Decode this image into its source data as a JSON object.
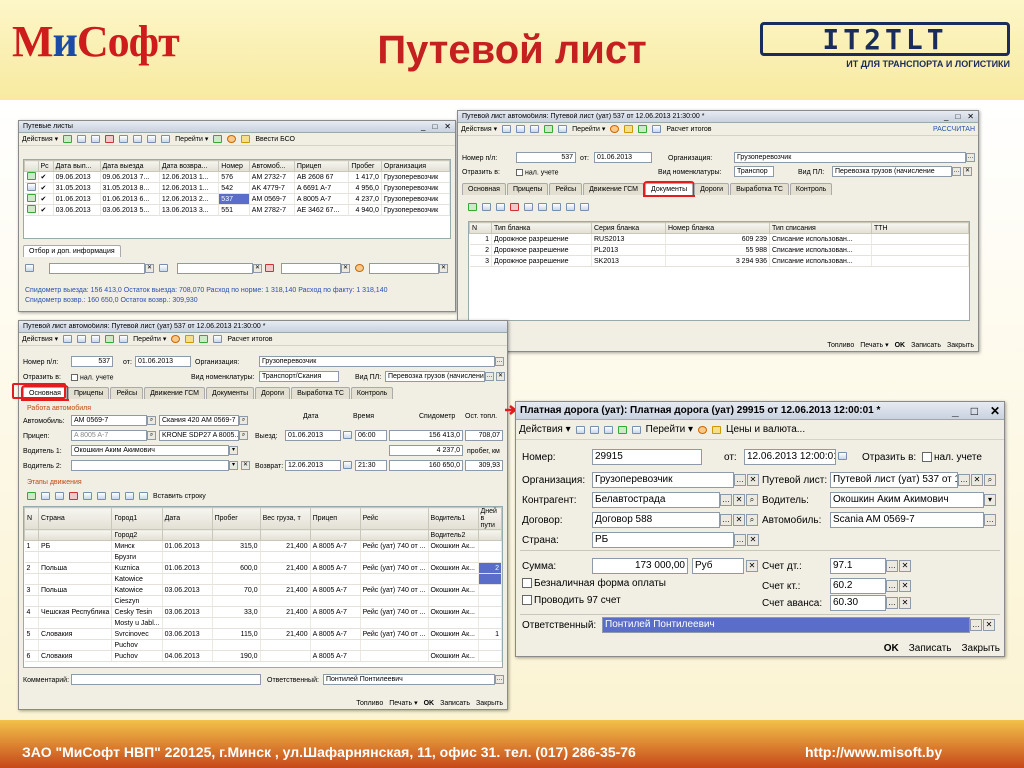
{
  "slide": {
    "logo_left_a": "М",
    "logo_left_b": "и",
    "logo_left_c": "Софт",
    "title": "Путевой лист",
    "logo_right": "IT2TLT",
    "logo_right_sub": "ИТ ДЛЯ ТРАНСПОРТА И ЛОГИСТИКИ",
    "footer_address": "ЗАО \"МиСофт НВП\"  220125, г.Минск , ул.Шафарнянская, 11, офис 31. тел. (017) 286-35-76",
    "footer_url": "http://www.misoft.by"
  },
  "w1": {
    "title": "Путевые листы",
    "toolbar": [
      "Действия ▾",
      "Перейти ▾",
      "Ввести БСО"
    ],
    "columns": [
      "Рс",
      "Дата вып...",
      "Дата выезда",
      "Дата возвра...",
      "Номер",
      "Автомоб...",
      "Прицеп",
      "Пробег",
      "Организация"
    ],
    "rows": [
      [
        "✔",
        "09.06.2013",
        "09.06.2013 7...",
        "12.06.2013 1...",
        "576",
        "AM 2732-7",
        "AB 2608 67",
        "1 417,0",
        "Грузоперевозчик"
      ],
      [
        "✔",
        "31.05.2013",
        "31.05.2013 8...",
        "12.06.2013 1...",
        "542",
        "AK 4779-7",
        "A 6691 A-7",
        "4 956,0",
        "Грузоперевозчик"
      ],
      [
        "✔",
        "01.06.2013",
        "01.06.2013 6...",
        "12.06.2013 2...",
        "537",
        "AM 0569-7",
        "A 8005 A-7",
        "4 237,0",
        "Грузоперевозчик"
      ],
      [
        "✔",
        "03.06.2013",
        "03.06.2013 5...",
        "13.06.2013 3...",
        "551",
        "AM 2782-7",
        "AE 3462 67...",
        "4 940,0",
        "Грузоперевозчик"
      ]
    ],
    "filter_tab": "Отбор и доп. информация",
    "stats1": "Спидометр выезда: 156 413,0     Остаток выезда: 708,070     Расход по норме: 1 318,140     Расход по факту: 1 318,140",
    "stats2": "Спидометр возвр.: 160 650,0     Остаток возвр.: 309,930"
  },
  "w2": {
    "title": "Путевой лист автомобиля: Путевой лист (уат) 537 от 12.06.2013 21:30:00 *",
    "toolbar": [
      "Действия ▾",
      "Перейти ▾",
      "Расчет итогов"
    ],
    "status": "РАССЧИТАН",
    "num_label": "Номер п/л:",
    "num": "537",
    "ot": "от:",
    "date": "01.06.2013",
    "org_label": "Организация:",
    "org": "Грузоперевозчик",
    "refl_label": "Отразить в:",
    "refl": "нал. учете",
    "nom_label": "Вид номенклатуры:",
    "nom": "Транспор",
    "vidpl_label": "Вид ПЛ:",
    "vidpl": "Перевозка грузов (начисление",
    "tabs": [
      "Основная",
      "Прицепы",
      "Рейсы",
      "Движение ГСМ",
      "Документы",
      "Дороги",
      "Выработка ТС",
      "Контроль"
    ],
    "columns": [
      "N",
      "Тип бланка",
      "Серия бланка",
      "Номер бланка",
      "Тип списания",
      "ТТН"
    ],
    "rows": [
      [
        "1",
        "Дорожное разрешение",
        "RUS2013",
        "609 239",
        "Списание использован...",
        ""
      ],
      [
        "2",
        "Дорожное разрешение",
        "PL2013",
        "55 988",
        "Списание использован...",
        ""
      ],
      [
        "3",
        "Дорожное разрешение",
        "SK2013",
        "3 294 936",
        "Списание использован...",
        ""
      ]
    ],
    "bottom": [
      "Топливо",
      "Печать ▾",
      "OK",
      "Записать",
      "Закрыть"
    ]
  },
  "w3": {
    "title": "Путевой лист автомобиля: Путевой лист (уат) 537 от 12.06.2013 21:30:00 *",
    "toolbar": [
      "Действия ▾",
      "Перейти ▾",
      "Расчет итогов"
    ],
    "num_label": "Номер п/л:",
    "num": "537",
    "ot": "от:",
    "date": "01.06.2013",
    "org_label": "Организация:",
    "org": "Грузоперевозчик",
    "refl_label": "Отразить в:",
    "refl": "нал. учете",
    "nom_label": "Вид номенклатуры:",
    "nom": "Транспорт/Скания",
    "vidpl_label": "Вид ПЛ:",
    "vidpl": "Перевозка грузов (начисление",
    "tabs": [
      "Основная",
      "Прицепы",
      "Рейсы",
      "Движение ГСМ",
      "Документы",
      "Дороги",
      "Выработка ТС",
      "Контроль"
    ],
    "sec_auto": "Работа автомобиля",
    "auto_label": "Автомобиль:",
    "auto": "AM 0569-7",
    "auto2": "Скания 420 AM 0569-7",
    "date_h": "Дата",
    "time_h": "Время",
    "spd_h": "Спидометр",
    "ost_h": "Ост. топл.",
    "trailer_label": "Прицеп:",
    "trailer": "A 8005 A-7",
    "trailer2": "KRONE  SDP27 A 8005...",
    "vyezd_label": "Выезд:",
    "vyezd_date": "01.06.2013",
    "vyezd_time": "06:00",
    "vyezd_spd": "156 413,0",
    "vyezd_ost": "708,07",
    "drv1_label": "Водитель 1:",
    "drv1": "Окошкин Аким Акимович",
    "run": "4 237,0",
    "run_unit": "пробег, км",
    "drv2_label": "Водитель 2:",
    "vozvr_label": "Возврат:",
    "vozvr_date": "12.06.2013",
    "vozvr_time": "21:30",
    "vozvr_spd": "160 650,0",
    "vozvr_ost": "309,93",
    "sec_route": "Этапы движения",
    "insert_row": "Вставить строку",
    "columns": [
      "N",
      "Страна",
      "Город1",
      "Дата",
      "Пробег",
      "Вес груза, т",
      "Прицеп",
      "Рейс",
      "Водитель1",
      "Дней в пути"
    ],
    "columns2": [
      "",
      "",
      "Город2",
      "",
      "",
      "",
      "",
      "",
      "Водитель2",
      ""
    ],
    "rows": [
      [
        "1",
        "РБ",
        "Минск",
        "Брузги",
        "01.06.2013",
        "315,0",
        "21,400",
        "A 8005 A-7",
        "Рейс (уат) 740 от ...",
        "Окошкин Ак...",
        ""
      ],
      [
        "2",
        "Польша",
        "Kuznica",
        "Katowice",
        "01.06.2013",
        "600,0",
        "21,400",
        "A 8005 A-7",
        "Рейс (уат) 740 от ...",
        "Окошкин Ак...",
        "2"
      ],
      [
        "3",
        "Польша",
        "Katowice",
        "Cieszyn",
        "03.06.2013",
        "70,0",
        "21,400",
        "A 8005 A-7",
        "Рейс (уат) 740 от ...",
        "Окошкин Ак...",
        ""
      ],
      [
        "4",
        "Чешская Республика",
        "Cesky Tesin",
        "Mosty u Jabl...",
        "03.06.2013",
        "33,0",
        "21,400",
        "A 8005 A-7",
        "Рейс (уат) 740 от ...",
        "Окошкин Ак...",
        ""
      ],
      [
        "5",
        "Словакия",
        "Svrcinovec",
        "Puchov",
        "03.06.2013",
        "115,0",
        "21,400",
        "A 8005 A-7",
        "Рейс (уат) 740 от ...",
        "Окошкин Ак...",
        "1"
      ],
      [
        "6",
        "Словакия",
        "Puchov",
        "",
        "04.06.2013",
        "190,0",
        "",
        "A 8005 A-7",
        "",
        "Окошкин Ак...",
        ""
      ]
    ],
    "comment_label": "Комментарий:",
    "resp_label": "Ответственный:",
    "resp": "Понтилей Понтилеевич",
    "bottom": [
      "Топливо",
      "Печать ▾",
      "OK",
      "Записать",
      "Закрыть"
    ]
  },
  "w4": {
    "title": "Платная дорога (уат): Платная дорога (уат) 29915 от 12.06.2013 12:00:01 *",
    "toolbar": [
      "Действия ▾",
      "Перейти ▾",
      "Цены и валюта..."
    ],
    "num_label": "Номер:",
    "num": "29915",
    "ot": "от:",
    "date": "12.06.2013 12:00:01",
    "refl_label": "Отразить в:",
    "refl": "нал. учете",
    "org_label": "Организация:",
    "org": "Грузоперевозчик",
    "pl_label": "Путевой лист:",
    "pl": "Путевой лист (уат) 537 от 12",
    "kontr_label": "Контрагент:",
    "kontr": "Белавтострада",
    "drv_label": "Водитель:",
    "drv": "Окошкин Аким Акимович",
    "dog_label": "Договор:",
    "dog": "Договор 588",
    "car_label": "Автомобиль:",
    "car": "Scania AM 0569-7",
    "country_label": "Страна:",
    "country": "РБ",
    "sum_label": "Сумма:",
    "sum": "173 000,00",
    "cur": "Руб",
    "dt_label": "Счет дт.:",
    "dt": "97.1",
    "cashless": "Безналичная форма оплаты",
    "kt_label": "Счет кт.:",
    "kt": "60.2",
    "post97": "Проводить 97 счет",
    "adv_label": "Счет аванса:",
    "adv": "60.30",
    "resp_label": "Ответственный:",
    "resp": "Понтилей Понтилеевич",
    "bottom": [
      "OK",
      "Записать",
      "Закрыть"
    ]
  }
}
